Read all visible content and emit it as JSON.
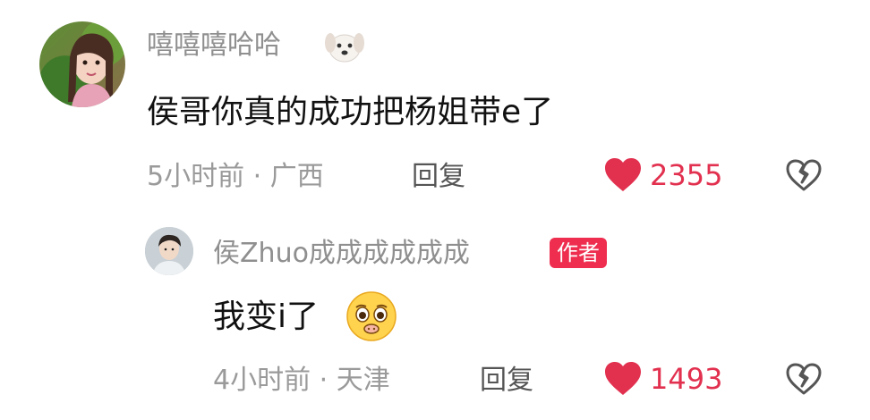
{
  "comment": {
    "username": "嘻嘻嘻哈哈",
    "username_emoji": "dog-face-icon",
    "text": "侯哥你真的成功把杨姐带e了",
    "meta": "5小时前 · 广西",
    "reply_label": "回复",
    "like_count": "2355",
    "like_icon": "heart-icon",
    "dislike_icon": "broken-heart-icon"
  },
  "reply": {
    "username": "侯Zhuo成成成成成成",
    "author_badge": "作者",
    "text": "我变i了",
    "emoji": "pleading-face-icon",
    "meta": "4小时前 · 天津",
    "reply_label": "回复",
    "like_count": "1493",
    "like_icon": "heart-icon",
    "dislike_icon": "broken-heart-icon"
  },
  "colors": {
    "like_red": "#e2304f",
    "badge_red": "#ee2d4f",
    "name_gray": "#8f8f8f"
  }
}
